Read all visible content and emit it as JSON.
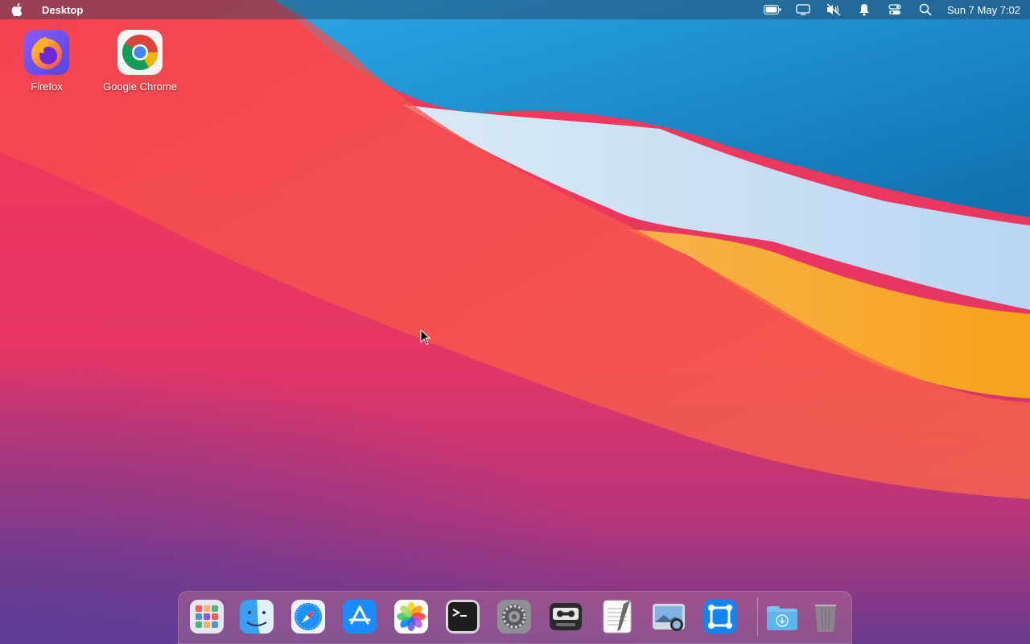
{
  "menubar": {
    "app_name": "Desktop",
    "clock": "Sun 7 May  7:02",
    "tray_icons": [
      "battery-icon",
      "display-icon",
      "volume-muted-icon",
      "notification-bell-icon",
      "control-center-icon",
      "search-icon"
    ]
  },
  "desktop_icons": [
    {
      "label": "Firefox",
      "icon": "firefox-icon"
    },
    {
      "label": "Google Chrome",
      "icon": "chrome-icon"
    }
  ],
  "dock": {
    "items": [
      {
        "icon": "launchpad-icon",
        "running": false
      },
      {
        "icon": "finder-icon",
        "running": false
      },
      {
        "icon": "safari-icon",
        "running": false
      },
      {
        "icon": "app-store-icon",
        "running": false
      },
      {
        "icon": "photos-icon",
        "running": false
      },
      {
        "icon": "terminal-icon",
        "running": false
      },
      {
        "icon": "system-preferences-icon",
        "running": false
      },
      {
        "icon": "tape-recorder-icon",
        "running": false
      },
      {
        "icon": "text-editor-icon",
        "running": true
      },
      {
        "icon": "screenshot-preview-icon",
        "running": false
      },
      {
        "icon": "xcode-like-icon",
        "running": true
      }
    ],
    "stack_items": [
      {
        "icon": "downloads-folder-icon"
      },
      {
        "icon": "trash-icon"
      }
    ]
  },
  "colors": {
    "accent": "#e8325a",
    "wallpaper_blue": "#1a8fd1",
    "wallpaper_orange": "#f7a21c"
  }
}
